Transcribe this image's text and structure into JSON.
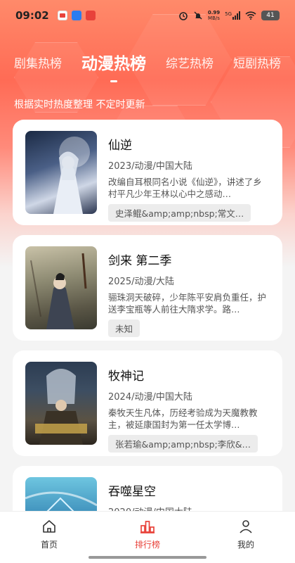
{
  "status_bar": {
    "time": "09:02",
    "net_speed": "0.99",
    "net_unit": "MB/s",
    "signal": "5G",
    "battery": "41"
  },
  "tabs": [
    {
      "label": "剧集热榜",
      "active": false
    },
    {
      "label": "动漫热榜",
      "active": true
    },
    {
      "label": "综艺热榜",
      "active": false
    },
    {
      "label": "短剧热榜",
      "active": false
    }
  ],
  "subtitle": "根据实时热度整理 不定时更新",
  "items": [
    {
      "title": "仙逆",
      "meta": "2023/动漫/中国大陆",
      "desc": "改编自耳根同名小说《仙逆》，讲述了乡村平凡少年王林以心中之感动…",
      "cast": "史泽鲲&amp;amp;nbsp;常文…"
    },
    {
      "title": "剑来 第二季",
      "meta": "2025/动漫/大陆",
      "desc": "骊珠洞天破碎，少年陈平安肩负重任，护送李宝瓶等人前往大隋求学。路…",
      "cast": "未知"
    },
    {
      "title": "牧神记",
      "meta": "2024/动漫/中国大陆",
      "desc": "秦牧天生凡体，历经考验成为天魔教教主，被延康国封为第一任太学博…",
      "cast": "张若瑜&amp;amp;nbsp;李欣&…"
    },
    {
      "title": "吞噬星空",
      "meta": "2020/动漫/中国大陆",
      "desc": "",
      "cast": ""
    }
  ],
  "bottom_nav": [
    {
      "label": "首页",
      "icon": "home-icon",
      "active": false
    },
    {
      "label": "排行榜",
      "icon": "ranking-icon",
      "active": true
    },
    {
      "label": "我的",
      "icon": "user-icon",
      "active": false
    }
  ],
  "colors": {
    "accent": "#e8423a",
    "hero_top": "#ff8a6a"
  }
}
